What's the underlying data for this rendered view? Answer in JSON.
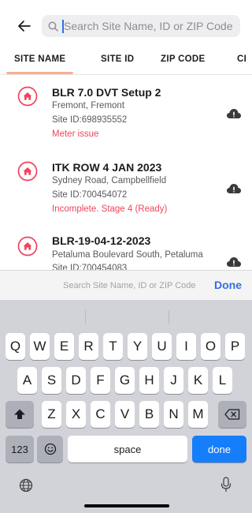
{
  "search": {
    "placeholder": "Search Site Name, ID or ZIP Code"
  },
  "tabs": [
    {
      "label": "SITE NAME"
    },
    {
      "label": "SITE ID"
    },
    {
      "label": "ZIP CODE"
    },
    {
      "label": "CI"
    }
  ],
  "sites": [
    {
      "name": "BLR 7.0 DVT Setup 2",
      "address": "Fremont, Fremont",
      "site_id": "Site ID:698935552",
      "status": "Meter issue"
    },
    {
      "name": "ITK ROW 4 JAN 2023",
      "address": "Sydney Road, Campbellfield",
      "site_id": "Site ID:700454072",
      "status": "Incomplete. Stage 4 (Ready)"
    },
    {
      "name": "BLR-19-04-12-2023",
      "address": "Petaluma Boulevard South, Petaluma",
      "site_id": "Site ID:700454083",
      "status": ""
    }
  ],
  "accessory": {
    "hint": "Search Site Name, ID or ZIP Code",
    "done_label": "Done"
  },
  "keyboard": {
    "row1": [
      "Q",
      "W",
      "E",
      "R",
      "T",
      "Y",
      "U",
      "I",
      "O",
      "P"
    ],
    "row2": [
      "A",
      "S",
      "D",
      "F",
      "G",
      "H",
      "J",
      "K",
      "L"
    ],
    "row3": [
      "Z",
      "X",
      "C",
      "V",
      "B",
      "N",
      "M"
    ],
    "numbers_label": "123",
    "space_label": "space",
    "done_label": "done"
  },
  "colors": {
    "accent_red": "#f0445d",
    "tab_underline": "#f7b08e",
    "keyboard_blue": "#157efb",
    "done_blue": "#2f6fe6"
  }
}
